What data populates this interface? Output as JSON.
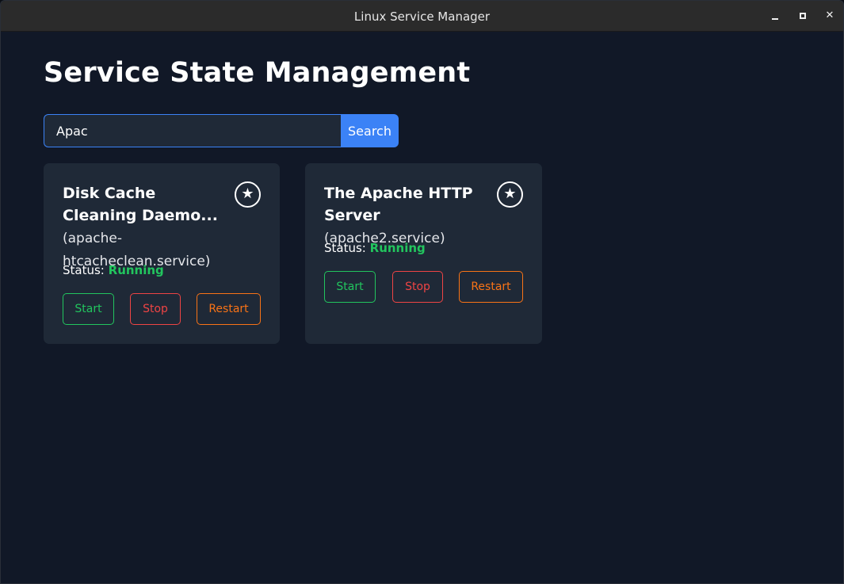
{
  "window": {
    "title": "Linux Service Manager"
  },
  "page": {
    "title": "Service State Management"
  },
  "search": {
    "value": "Apac",
    "button_label": "Search"
  },
  "services": [
    {
      "title": "Disk Cache Cleaning Daemo...",
      "unit": "(apache-htcacheclean.service)",
      "status_label": "Status:",
      "status_value": "Running",
      "favorite_icon": "star-icon",
      "actions": {
        "start": "Start",
        "stop": "Stop",
        "restart": "Restart"
      }
    },
    {
      "title": "The Apache HTTP Server",
      "unit": "(apache2.service)",
      "status_label": "Status:",
      "status_value": "Running",
      "favorite_icon": "star-icon",
      "actions": {
        "start": "Start",
        "stop": "Stop",
        "restart": "Restart"
      }
    }
  ],
  "colors": {
    "background": "#111827",
    "card": "#1f2937",
    "accent": "#3b82f6",
    "running": "#22c55e",
    "stop": "#ef4444",
    "restart": "#f97316"
  }
}
